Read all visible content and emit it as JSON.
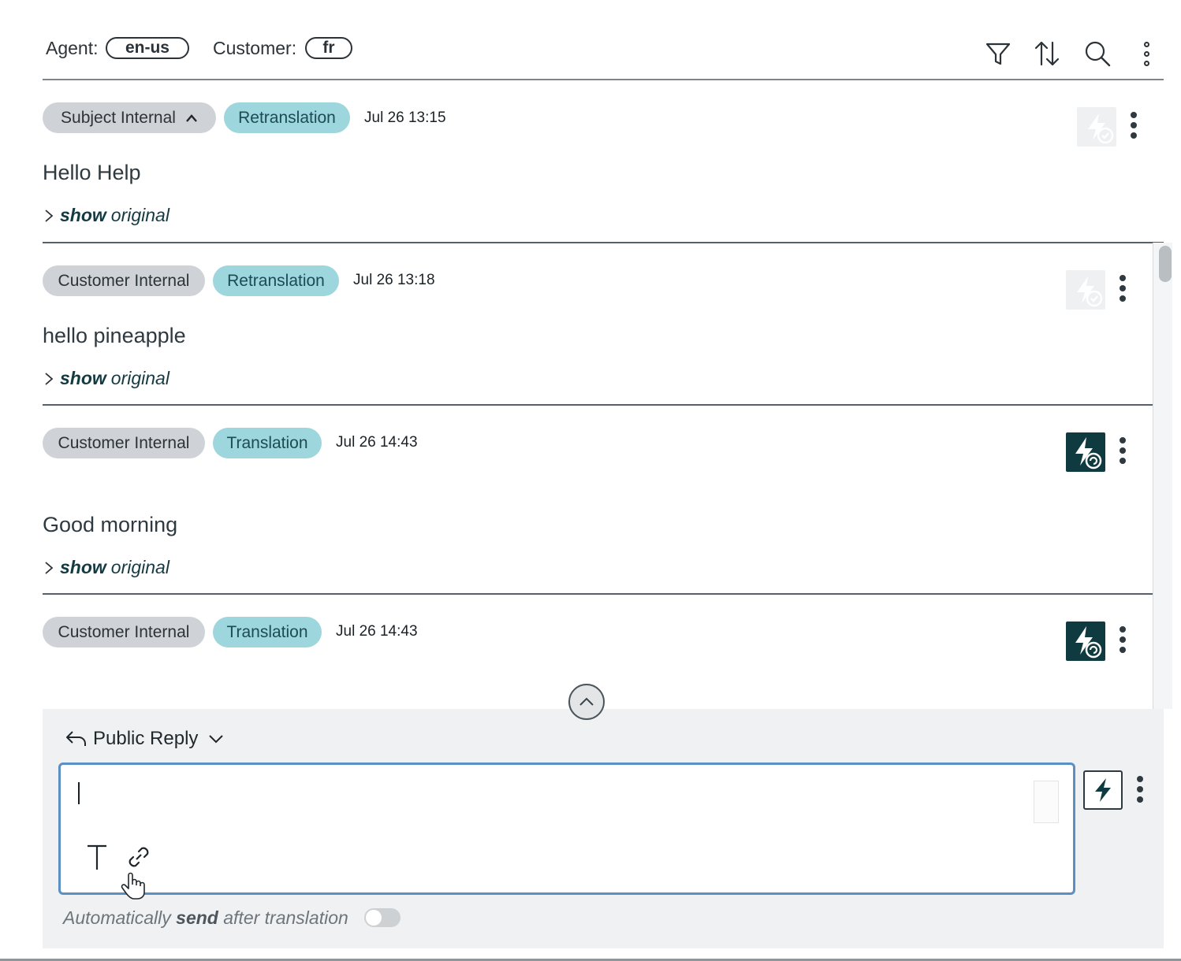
{
  "header": {
    "agent_label": "Agent:",
    "agent_lang": "en-us",
    "customer_label": "Customer:",
    "customer_lang": "fr",
    "icons": [
      "filter-icon",
      "sort-icon",
      "search-icon",
      "more-vertical-icon"
    ]
  },
  "messages": [
    {
      "type_label": "Subject Internal",
      "status_label": "Retranslation",
      "time": "Jul 26 13:15",
      "text": "Hello Help",
      "show_original": {
        "bold": "show",
        "rest": "original"
      },
      "translate_icon": "translate-done-icon-faded"
    },
    {
      "type_label": "Customer Internal",
      "status_label": "Retranslation",
      "time": "Jul 26 13:18",
      "text": "hello pineapple",
      "show_original": {
        "bold": "show",
        "rest": "original"
      },
      "translate_icon": "translate-done-icon-faded"
    },
    {
      "type_label": "Customer Internal",
      "status_label": "Translation",
      "time": "Jul 26 14:43",
      "text": "Good morning",
      "show_original": {
        "bold": "show",
        "rest": "original"
      },
      "translate_icon": "translate-refresh-icon"
    },
    {
      "type_label": "Customer Internal",
      "status_label": "Translation",
      "time": "Jul 26 14:43",
      "translate_icon": "translate-refresh-icon"
    }
  ],
  "reply": {
    "mode_label": "Public Reply",
    "input_value": "",
    "input_placeholder": "",
    "auto_send": {
      "pre": "Automatically ",
      "bold": "send",
      "post": " after translation"
    },
    "auto_send_enabled": false
  },
  "colors": {
    "grey_tag": "#cfd3d8",
    "teal_tag": "#9dd6dc",
    "dark_icon": "#0f3b40",
    "editor_border": "#5c8fc2"
  }
}
